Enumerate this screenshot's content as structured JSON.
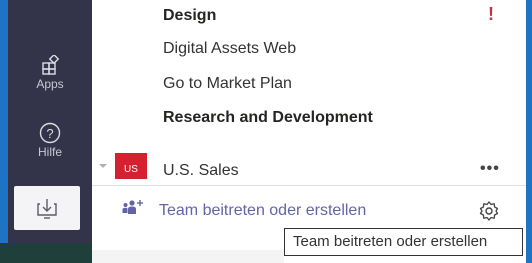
{
  "rail": {
    "items": [
      {
        "label": "Apps",
        "icon": "apps-icon"
      },
      {
        "label": "Hilfe",
        "icon": "help-icon"
      }
    ],
    "download_icon": "download-icon"
  },
  "channels": [
    {
      "name": "Design",
      "bold": true,
      "alert": "!"
    },
    {
      "name": "Digital Assets Web",
      "bold": false
    },
    {
      "name": "Go to Market Plan",
      "bold": false
    },
    {
      "name": "Research and Development",
      "bold": true
    }
  ],
  "team": {
    "badge": "US",
    "name": "U.S. Sales",
    "more": "•••"
  },
  "join": {
    "label": "Team beitreten oder erstellen"
  },
  "tooltip": {
    "text": "Team beitreten oder erstellen"
  },
  "colors": {
    "accent": "#1e73c4",
    "rail": "#33344a",
    "brand": "#6264a7",
    "team_badge": "#d4202f"
  }
}
